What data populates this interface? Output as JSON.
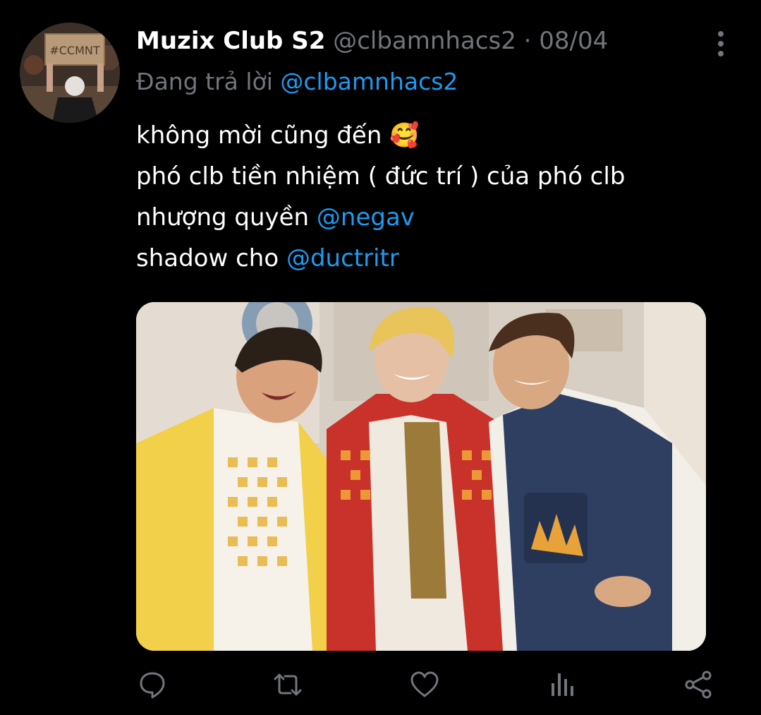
{
  "tweet": {
    "display_name": "Muzix Club S2",
    "handle": "@clbamnhacs2",
    "separator": "·",
    "date": "08/04",
    "reply_label": "Đang trả lời",
    "reply_to": "@clbamnhacs2",
    "lines": {
      "line1_text": "không mời cũng đến",
      "line1_emoji": "🥰",
      "line2_text": "phó clb tiền nhiệm ( đức trí ) của phó clb",
      "line3_text": "nhượng quyền",
      "line3_mention": "@negav",
      "line4_text": "shadow cho",
      "line4_mention": "@ductritr"
    },
    "avatar_sign_text": "#CCMNT"
  },
  "actions": [
    {
      "name": "reply",
      "icon": "speech-bubble-icon"
    },
    {
      "name": "retweet",
      "icon": "retweet-icon"
    },
    {
      "name": "like",
      "icon": "heart-icon"
    },
    {
      "name": "views",
      "icon": "bar-chart-icon"
    },
    {
      "name": "share",
      "icon": "share-icon"
    }
  ],
  "colors": {
    "background": "#000000",
    "text_primary": "#ffffff",
    "text_secondary": "#71767b",
    "accent": "#1d9bf0"
  }
}
